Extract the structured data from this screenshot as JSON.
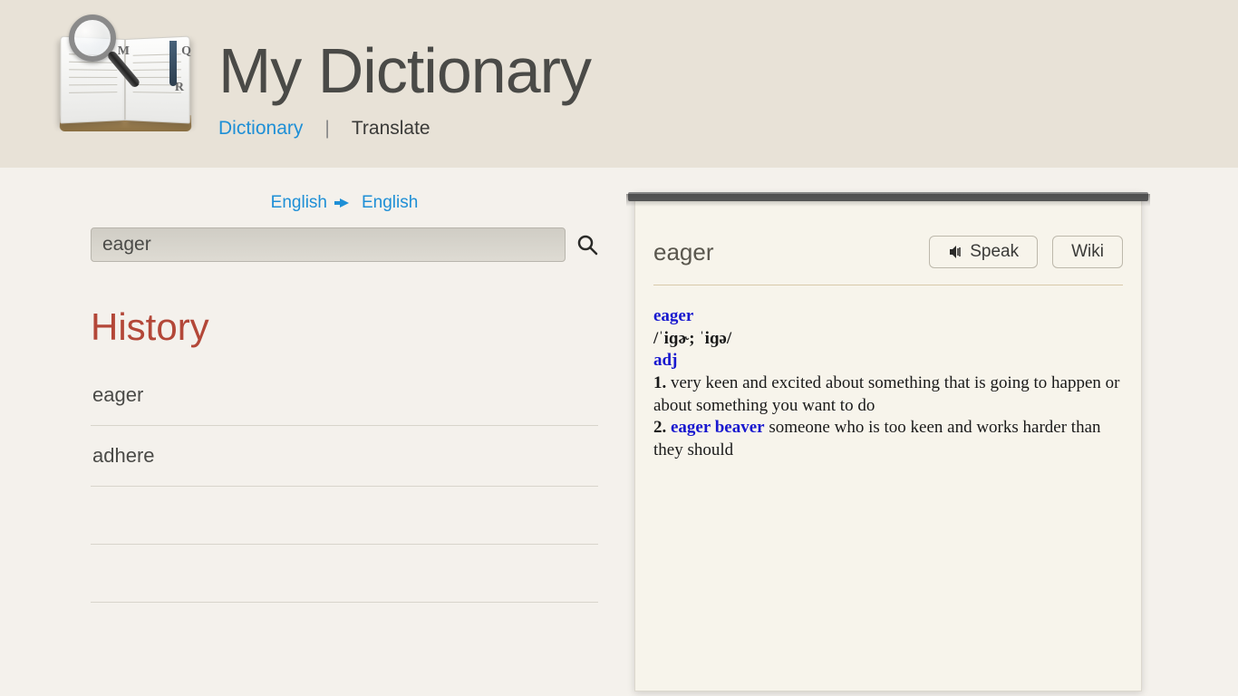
{
  "header": {
    "title": "My Dictionary",
    "tabs": {
      "dictionary": "Dictionary",
      "translate": "Translate"
    }
  },
  "search": {
    "lang_from": "English",
    "lang_to": "English",
    "value": "eager"
  },
  "history": {
    "title": "History",
    "items": [
      "eager",
      "adhere"
    ]
  },
  "definition": {
    "word": "eager",
    "speak_label": "Speak",
    "wiki_label": "Wiki",
    "headword": "eager",
    "pronunciation": "/ˈiɡɚ; ˈiɡə/",
    "pos": "adj",
    "senses": [
      {
        "num": "1.",
        "phrase": "",
        "text": "very keen and excited about something that is going to happen or about something you want to do"
      },
      {
        "num": "2.",
        "phrase": "eager beaver",
        "text": "someone who is too keen and works harder than they should"
      }
    ]
  }
}
